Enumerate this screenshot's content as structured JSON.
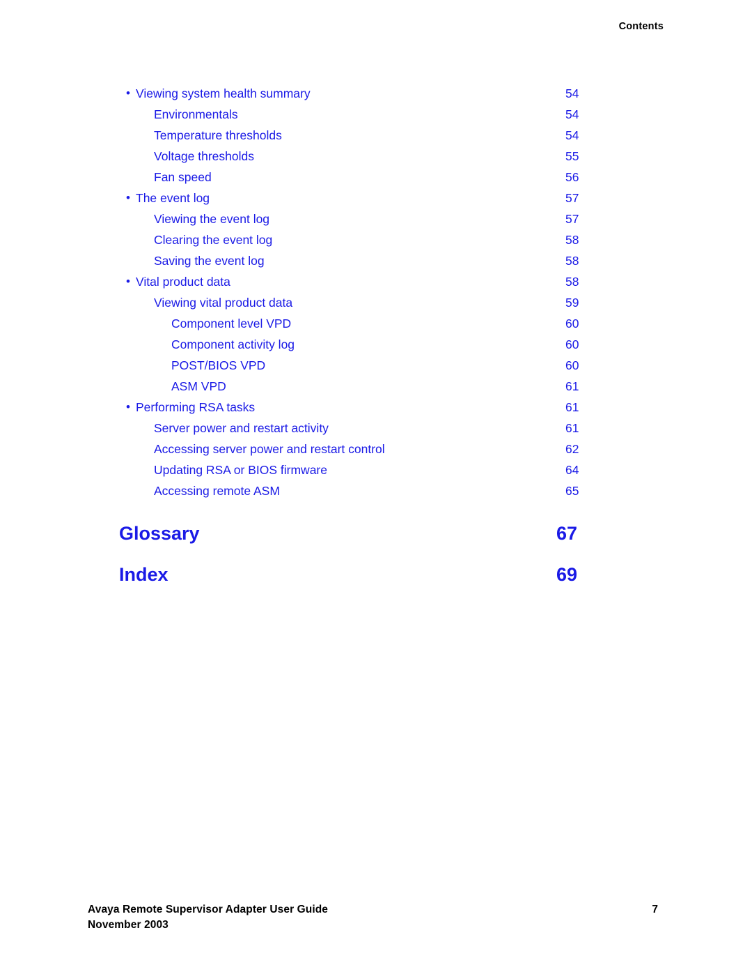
{
  "header": {
    "running_title": "Contents"
  },
  "colors": {
    "link_blue": "#1a1ae6",
    "text_black": "#000000",
    "page_background": "#ffffff"
  },
  "toc": {
    "bullet_glyph": "•",
    "entries": [
      {
        "level": 1,
        "bullet": true,
        "title": "Viewing system health summary",
        "page": "54"
      },
      {
        "level": 2,
        "bullet": false,
        "title": "Environmentals",
        "page": "54"
      },
      {
        "level": 2,
        "bullet": false,
        "title": "Temperature thresholds",
        "page": "54"
      },
      {
        "level": 2,
        "bullet": false,
        "title": "Voltage thresholds",
        "page": "55"
      },
      {
        "level": 2,
        "bullet": false,
        "title": "Fan speed",
        "page": "56"
      },
      {
        "level": 1,
        "bullet": true,
        "title": "The event log",
        "page": "57"
      },
      {
        "level": 2,
        "bullet": false,
        "title": "Viewing the event log",
        "page": "57"
      },
      {
        "level": 2,
        "bullet": false,
        "title": "Clearing the event log",
        "page": "58"
      },
      {
        "level": 2,
        "bullet": false,
        "title": "Saving the event log",
        "page": "58"
      },
      {
        "level": 1,
        "bullet": true,
        "title": "Vital product data",
        "page": "58"
      },
      {
        "level": 2,
        "bullet": false,
        "title": "Viewing vital product data",
        "page": "59"
      },
      {
        "level": 3,
        "bullet": false,
        "title": "Component level VPD",
        "page": "60"
      },
      {
        "level": 3,
        "bullet": false,
        "title": "Component activity log",
        "page": "60"
      },
      {
        "level": 3,
        "bullet": false,
        "title": "POST/BIOS VPD",
        "page": "60"
      },
      {
        "level": 3,
        "bullet": false,
        "title": "ASM VPD",
        "page": "61"
      },
      {
        "level": 1,
        "bullet": true,
        "title": "Performing RSA tasks",
        "page": "61"
      },
      {
        "level": 2,
        "bullet": false,
        "title": "Server power and restart activity",
        "page": "61"
      },
      {
        "level": 2,
        "bullet": false,
        "title": "Accessing server power and restart control",
        "page": "62"
      },
      {
        "level": 2,
        "bullet": false,
        "title": "Updating RSA or BIOS firmware",
        "page": "64"
      },
      {
        "level": 2,
        "bullet": false,
        "title": "Accessing remote ASM",
        "page": "65"
      }
    ]
  },
  "back_matter": {
    "glossary": {
      "title": "Glossary",
      "page": "67"
    },
    "index": {
      "title": "Index",
      "page": "69"
    }
  },
  "footer": {
    "document_title": "Avaya Remote Supervisor Adapter User Guide",
    "date": "November 2003",
    "page_number": "7"
  }
}
